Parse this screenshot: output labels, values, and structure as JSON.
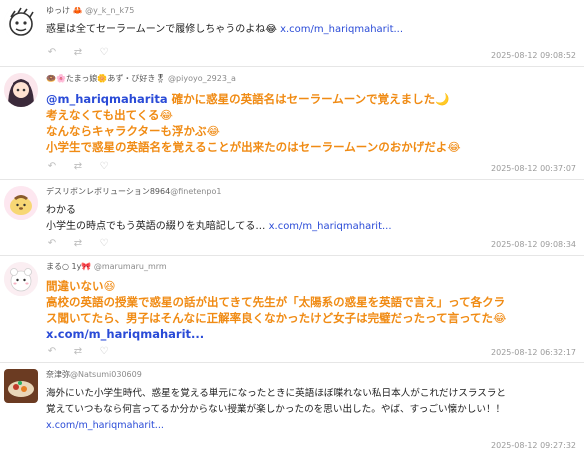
{
  "posts": [
    {
      "display_name": "ゆっけ 🦀",
      "handle": "@y_k_n_k75",
      "lines": [
        {
          "parts": [
            {
              "text": "惑星は全てセーラームーンで履修しちゃうのよね😂 ",
              "cls": ""
            },
            {
              "text": "x.com/m_hariqmaharit...",
              "cls": "link"
            }
          ]
        }
      ],
      "timestamp": "2025-08-12 09:08:52",
      "avatar_icon": "cartoon-face-icon"
    },
    {
      "display_name": "🍩🌸たまっ娘🌼あず・び好き🎖",
      "handle": "@piyoyo_2923_a",
      "lines": [
        {
          "parts": [
            {
              "text": "@m_hariqmaharita",
              "cls": "blue"
            },
            {
              "text": " 確かに惑星の英語名はセーラームーンで覚えました🌙",
              "cls": "orange"
            }
          ]
        },
        {
          "parts": [
            {
              "text": "考えなくても出てくる😂",
              "cls": "orange"
            }
          ]
        },
        {
          "parts": [
            {
              "text": "なんならキャラクターも浮かぶ😂",
              "cls": "orange"
            }
          ]
        },
        {
          "parts": [
            {
              "text": "小学生で惑星の英語名を覚えることが出来たのはセーラームーンのおかげだよ😂",
              "cls": "orange"
            }
          ]
        }
      ],
      "timestamp": "2025-08-12 00:37:07",
      "avatar_icon": "anime-girl-icon"
    },
    {
      "display_name": "デスリボンレボリューション8964",
      "handle": "@finetenpo1",
      "lines": [
        {
          "parts": [
            {
              "text": "わかる",
              "cls": ""
            }
          ]
        },
        {
          "parts": [
            {
              "text": "小学生の時点でもう英語の綴りを丸暗記してる… ",
              "cls": ""
            },
            {
              "text": "x.com/m_hariqmaharit...",
              "cls": "link"
            }
          ]
        }
      ],
      "timestamp": "2025-08-12 09:08:34",
      "avatar_icon": "pompompurin-icon"
    },
    {
      "display_name": "まる○ 1y🎀",
      "handle": "@marumaru_mrm",
      "lines": [
        {
          "parts": [
            {
              "text": "間違いない😆",
              "cls": "orange"
            }
          ]
        },
        {
          "parts": [
            {
              "text": "高校の英語の授業で惑星の話が出てきて先生が「太陽系の惑星を英語で言え」って各クラ",
              "cls": "orange"
            }
          ]
        },
        {
          "parts": [
            {
              "text": "ス聞いてたら、男子はそんなに正解率良くなかったけど女子は完璧だったって言ってた😂",
              "cls": "orange"
            }
          ]
        },
        {
          "parts": [
            {
              "text": "x.com/m_hariqmaharit...",
              "cls": "blue"
            }
          ]
        }
      ],
      "timestamp": "2025-08-12 06:32:17",
      "avatar_icon": "chiikawa-icon"
    },
    {
      "display_name": "奈津弥",
      "handle": "@Natsumi030609",
      "lines": [
        {
          "parts": [
            {
              "text": "海外にいた小学生時代、惑星を覚える単元になったときに英語ほぼ喋れない私日本人がこれだけスラスラと",
              "cls": ""
            }
          ]
        },
        {
          "parts": [
            {
              "text": "覚えていつもなら何言ってるか分からない授業が楽しかったのを思い出した。やば、すっごい懐かしい！！ ",
              "cls": ""
            }
          ]
        },
        {
          "parts": [
            {
              "text": "x.com/m_hariqmaharit...",
              "cls": "link"
            }
          ]
        }
      ],
      "timestamp": "2025-08-12 09:27:32",
      "avatar_icon": "food-photo-icon"
    }
  ],
  "action_icons": [
    "reply-icon",
    "retweet-icon",
    "like-icon"
  ],
  "action_glyphs": {
    "reply": "↶",
    "retweet": "⇄",
    "like": "♡"
  }
}
